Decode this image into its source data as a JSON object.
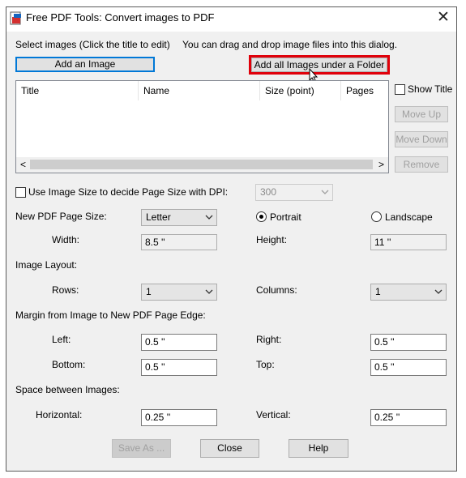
{
  "window": {
    "title": "Free PDF Tools: Convert images to PDF",
    "close_glyph": "✕"
  },
  "images": {
    "select_label": "Select images (Click the title to edit)",
    "drag_hint": "You can drag and drop image files into this dialog.",
    "add_image_label": "Add an Image",
    "add_folder_label": "Add all Images under a Folder",
    "columns": [
      "Title",
      "Name",
      "Size (point)",
      "Pages"
    ],
    "show_title_label": "Show Title",
    "move_up_label": "Move Up",
    "move_down_label": "Move Down",
    "remove_label": "Remove",
    "scroll_left_glyph": "<",
    "scroll_right_glyph": ">"
  },
  "page_size": {
    "use_image_size_label": "Use Image Size to decide Page Size with DPI:",
    "dpi_value": "300",
    "new_page_size_label": "New PDF Page Size:",
    "page_size_value": "Letter",
    "portrait_label": "Portrait",
    "landscape_label": "Landscape",
    "width_label": "Width:",
    "width_value": "8.5 ''",
    "height_label": "Height:",
    "height_value": "11 ''"
  },
  "layout": {
    "section_label": "Image Layout:",
    "rows_label": "Rows:",
    "rows_value": "1",
    "columns_label": "Columns:",
    "columns_value": "1"
  },
  "margin": {
    "section_label": "Margin from Image to New PDF Page Edge:",
    "left_label": "Left:",
    "left_value": "0.5 ''",
    "right_label": "Right:",
    "right_value": "0.5 ''",
    "bottom_label": "Bottom:",
    "bottom_value": "0.5 ''",
    "top_label": "Top:",
    "top_value": "0.5 ''"
  },
  "spacing": {
    "section_label": "Space between Images:",
    "horizontal_label": "Horizontal:",
    "horizontal_value": "0.25 ''",
    "vertical_label": "Vertical:",
    "vertical_value": "0.25 ''"
  },
  "footer": {
    "save_as_label": "Save As ...",
    "close_label": "Close",
    "help_label": "Help"
  },
  "colors": {
    "highlight": "#e0000a",
    "accent": "#0078d7",
    "dialog_bg": "#f0f0f0"
  },
  "icons": {
    "app": "pdf-app-icon",
    "cursor": "mouse-cursor-icon",
    "dropdown": "chevron-down-icon"
  }
}
